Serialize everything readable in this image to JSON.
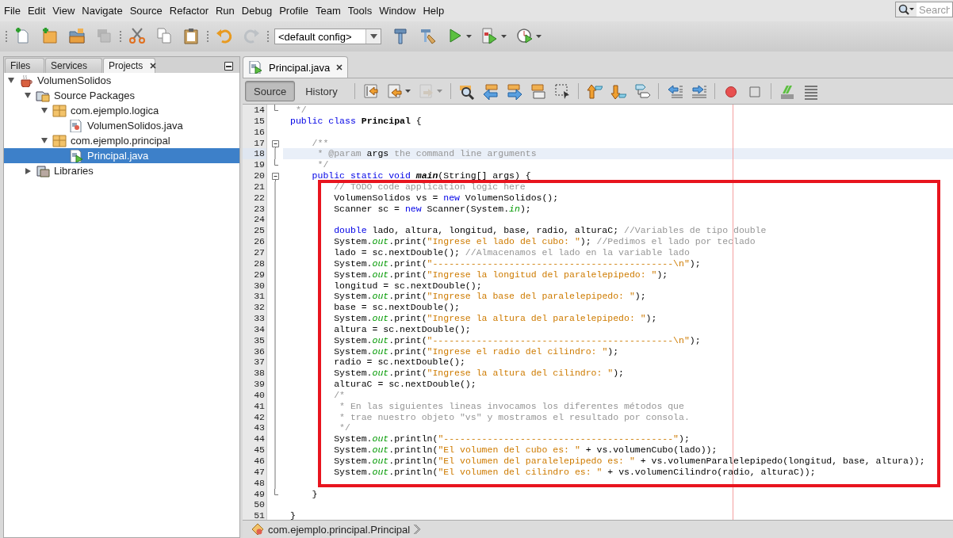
{
  "menu": [
    "File",
    "Edit",
    "View",
    "Navigate",
    "Source",
    "Refactor",
    "Run",
    "Debug",
    "Profile",
    "Team",
    "Tools",
    "Window",
    "Help"
  ],
  "search": {
    "placeholder": "Search"
  },
  "toolbar": {
    "groups": [
      [
        {
          "kind": "new-file",
          "disabled": false
        },
        {
          "kind": "new-project",
          "disabled": false
        },
        {
          "kind": "open-project",
          "disabled": false
        },
        {
          "kind": "save-all",
          "disabled": true
        }
      ],
      [
        {
          "kind": "cut",
          "disabled": false
        },
        {
          "kind": "copy",
          "disabled": false
        },
        {
          "kind": "paste",
          "disabled": false
        }
      ],
      [
        {
          "kind": "undo",
          "disabled": false
        },
        {
          "kind": "redo",
          "disabled": true
        }
      ],
      [
        {
          "kind": "config",
          "value": "<default config>"
        },
        {
          "kind": "build",
          "disabled": false
        },
        {
          "kind": "clean-build",
          "disabled": false
        },
        {
          "kind": "run",
          "disabled": false,
          "dropdown": true
        },
        {
          "kind": "debug",
          "disabled": false,
          "dropdown": true
        },
        {
          "kind": "profile",
          "disabled": false,
          "dropdown": true
        }
      ]
    ]
  },
  "side_tabs": [
    {
      "label": "Files",
      "selected": false
    },
    {
      "label": "Services",
      "selected": false
    },
    {
      "label": "Projects",
      "selected": true
    }
  ],
  "project_tree": [
    {
      "label": "VolumenSolidos",
      "kind": "project",
      "expanded": true,
      "selected": false,
      "children": [
        {
          "label": "Source Packages",
          "kind": "source-root",
          "expanded": true,
          "selected": false,
          "children": [
            {
              "label": "com.ejemplo.logica",
              "kind": "package",
              "expanded": true,
              "selected": false,
              "children": [
                {
                  "label": "VolumenSolidos.java",
                  "kind": "class-file",
                  "selected": false
                }
              ]
            },
            {
              "label": "com.ejemplo.principal",
              "kind": "package",
              "expanded": true,
              "selected": false,
              "children": [
                {
                  "label": "Principal.java",
                  "kind": "main-file",
                  "selected": true
                }
              ]
            }
          ]
        },
        {
          "label": "Libraries",
          "kind": "libraries",
          "expanded": false,
          "selected": false
        }
      ]
    }
  ],
  "editor_tabs": [
    {
      "label": "Principal.java",
      "selected": true
    }
  ],
  "view_tabs": [
    {
      "label": "Source",
      "selected": true
    },
    {
      "label": "History",
      "selected": false
    }
  ],
  "editor_toolbar": {
    "groups": [
      [
        {
          "kind": "last-edit",
          "disabled": false
        },
        {
          "kind": "back",
          "disabled": false,
          "dropdown": true
        },
        {
          "kind": "forward",
          "disabled": true,
          "dropdown": true
        }
      ],
      [
        {
          "kind": "find",
          "disabled": false
        },
        {
          "kind": "prev-occurrence",
          "disabled": false
        },
        {
          "kind": "next-occurrence",
          "disabled": false
        },
        {
          "kind": "toggle-highlight",
          "disabled": false
        },
        {
          "kind": "rect-select",
          "disabled": false
        }
      ],
      [
        {
          "kind": "prev-bookmark",
          "disabled": false
        },
        {
          "kind": "next-bookmark",
          "disabled": false
        },
        {
          "kind": "toggle-bookmark",
          "disabled": false
        }
      ],
      [
        {
          "kind": "shift-left",
          "disabled": false
        },
        {
          "kind": "shift-right",
          "disabled": false
        }
      ],
      [
        {
          "kind": "record-macro",
          "disabled": false
        },
        {
          "kind": "stop-macro",
          "disabled": false
        }
      ],
      [
        {
          "kind": "comment",
          "disabled": false
        },
        {
          "kind": "uncomment",
          "disabled": false
        }
      ]
    ]
  },
  "code": {
    "lines": [
      {
        "number": "14",
        "kind": "end",
        "current": false,
        "tokens": [
          {
            "kind": "comment",
            "text": " */"
          }
        ]
      },
      {
        "number": "15",
        "kind": "plain",
        "current": false,
        "tokens": [
          {
            "kind": "keyword",
            "text": "public class"
          },
          {
            "kind": "class",
            "text": " Principal"
          },
          {
            "kind": "plain",
            "text": " {"
          }
        ]
      },
      {
        "number": "16",
        "kind": "plain"
      },
      {
        "number": "17",
        "kind": "start",
        "current": false,
        "tokens": [
          {
            "kind": "comment",
            "text": "    /**"
          }
        ]
      },
      {
        "number": "18",
        "kind": "body",
        "current": true,
        "tokens": [
          {
            "kind": "comment",
            "text": "     * @param"
          },
          {
            "kind": "plain",
            "text": " args"
          },
          {
            "kind": "comment",
            "text": " the command line arguments"
          }
        ]
      },
      {
        "number": "19",
        "kind": "end",
        "current": false,
        "tokens": [
          {
            "kind": "comment",
            "text": "     */"
          }
        ]
      },
      {
        "number": "20",
        "kind": "start",
        "current": false,
        "tokens": [
          {
            "kind": "keyword",
            "text": "    public static void"
          },
          {
            "kind": "method",
            "text": " main"
          },
          {
            "kind": "plain",
            "text": "(String[] args) {"
          }
        ]
      },
      {
        "number": "21",
        "kind": "body",
        "current": false,
        "tokens": [
          {
            "kind": "comment",
            "text": "        // TODO code application logic here"
          }
        ]
      },
      {
        "number": "22",
        "kind": "body",
        "current": false,
        "tokens": [
          {
            "kind": "plain",
            "text": "        VolumenSolidos vs ="
          },
          {
            "kind": "keyword",
            "text": " new"
          },
          {
            "kind": "plain",
            "text": " VolumenSolidos();"
          }
        ]
      },
      {
        "number": "23",
        "kind": "body",
        "current": false,
        "tokens": [
          {
            "kind": "plain",
            "text": "        Scanner sc ="
          },
          {
            "kind": "keyword",
            "text": " new"
          },
          {
            "kind": "plain",
            "text": " Scanner(System."
          },
          {
            "kind": "field",
            "text": "in"
          },
          {
            "kind": "plain",
            "text": ");"
          }
        ]
      },
      {
        "number": "24",
        "kind": "body"
      },
      {
        "number": "25",
        "kind": "body",
        "current": false,
        "tokens": [
          {
            "kind": "keyword",
            "text": "        double"
          },
          {
            "kind": "plain",
            "text": " lado, altura, longitud, base, radio, alturaC;"
          },
          {
            "kind": "comment",
            "text": " //Variables de tipo double"
          }
        ]
      },
      {
        "number": "26",
        "kind": "body",
        "current": false,
        "tokens": [
          {
            "kind": "plain",
            "text": "        System."
          },
          {
            "kind": "field",
            "text": "out"
          },
          {
            "kind": "plain",
            "text": ".print("
          },
          {
            "kind": "string",
            "text": "\"Ingrese el lado del cubo: \""
          },
          {
            "kind": "plain",
            "text": ");"
          },
          {
            "kind": "comment",
            "text": " //Pedimos el lado por teclado"
          }
        ]
      },
      {
        "number": "27",
        "kind": "body",
        "current": false,
        "tokens": [
          {
            "kind": "plain",
            "text": "        lado = sc.nextDouble();"
          },
          {
            "kind": "comment",
            "text": " //Almacenamos el lado en la variable lado"
          }
        ]
      },
      {
        "number": "28",
        "kind": "body",
        "current": false,
        "tokens": [
          {
            "kind": "plain",
            "text": "        System."
          },
          {
            "kind": "field",
            "text": "out"
          },
          {
            "kind": "plain",
            "text": ".print("
          },
          {
            "kind": "string",
            "text": "\"--------------------------------------------\\n\""
          },
          {
            "kind": "plain",
            "text": ");"
          }
        ]
      },
      {
        "number": "29",
        "kind": "body",
        "current": false,
        "tokens": [
          {
            "kind": "plain",
            "text": "        System."
          },
          {
            "kind": "field",
            "text": "out"
          },
          {
            "kind": "plain",
            "text": ".print("
          },
          {
            "kind": "string",
            "text": "\"Ingrese la longitud del paralelepipedo: \""
          },
          {
            "kind": "plain",
            "text": ");"
          }
        ]
      },
      {
        "number": "30",
        "kind": "body",
        "current": false,
        "tokens": [
          {
            "kind": "plain",
            "text": "        longitud = sc.nextDouble();"
          }
        ]
      },
      {
        "number": "31",
        "kind": "body",
        "current": false,
        "tokens": [
          {
            "kind": "plain",
            "text": "        System."
          },
          {
            "kind": "field",
            "text": "out"
          },
          {
            "kind": "plain",
            "text": ".print("
          },
          {
            "kind": "string",
            "text": "\"Ingrese la base del paralelepipedo: \""
          },
          {
            "kind": "plain",
            "text": ");"
          }
        ]
      },
      {
        "number": "32",
        "kind": "body",
        "current": false,
        "tokens": [
          {
            "kind": "plain",
            "text": "        base = sc.nextDouble();"
          }
        ]
      },
      {
        "number": "33",
        "kind": "body",
        "current": false,
        "tokens": [
          {
            "kind": "plain",
            "text": "        System."
          },
          {
            "kind": "field",
            "text": "out"
          },
          {
            "kind": "plain",
            "text": ".print("
          },
          {
            "kind": "string",
            "text": "\"Ingrese la altura del paralelepipedo: \""
          },
          {
            "kind": "plain",
            "text": ");"
          }
        ]
      },
      {
        "number": "34",
        "kind": "body",
        "current": false,
        "tokens": [
          {
            "kind": "plain",
            "text": "        altura = sc.nextDouble();"
          }
        ]
      },
      {
        "number": "35",
        "kind": "body",
        "current": false,
        "tokens": [
          {
            "kind": "plain",
            "text": "        System."
          },
          {
            "kind": "field",
            "text": "out"
          },
          {
            "kind": "plain",
            "text": ".print("
          },
          {
            "kind": "string",
            "text": "\"--------------------------------------------\\n\""
          },
          {
            "kind": "plain",
            "text": ");"
          }
        ]
      },
      {
        "number": "36",
        "kind": "body",
        "current": false,
        "tokens": [
          {
            "kind": "plain",
            "text": "        System."
          },
          {
            "kind": "field",
            "text": "out"
          },
          {
            "kind": "plain",
            "text": ".print("
          },
          {
            "kind": "string",
            "text": "\"Ingrese el radio del cilindro: \""
          },
          {
            "kind": "plain",
            "text": ");"
          }
        ]
      },
      {
        "number": "37",
        "kind": "body",
        "current": false,
        "tokens": [
          {
            "kind": "plain",
            "text": "        radio = sc.nextDouble();"
          }
        ]
      },
      {
        "number": "38",
        "kind": "body",
        "current": false,
        "tokens": [
          {
            "kind": "plain",
            "text": "        System."
          },
          {
            "kind": "field",
            "text": "out"
          },
          {
            "kind": "plain",
            "text": ".print("
          },
          {
            "kind": "string",
            "text": "\"Ingrese la altura del cilindro: \""
          },
          {
            "kind": "plain",
            "text": ");"
          }
        ]
      },
      {
        "number": "39",
        "kind": "body",
        "current": false,
        "tokens": [
          {
            "kind": "plain",
            "text": "        alturaC = sc.nextDouble();"
          }
        ]
      },
      {
        "number": "40",
        "kind": "body",
        "current": false,
        "tokens": [
          {
            "kind": "comment",
            "text": "        /*"
          }
        ]
      },
      {
        "number": "41",
        "kind": "body",
        "current": false,
        "tokens": [
          {
            "kind": "comment",
            "text": "         * En las siguientes lineas invocamos los diferentes métodos que"
          }
        ]
      },
      {
        "number": "42",
        "kind": "body",
        "current": false,
        "tokens": [
          {
            "kind": "comment",
            "text": "         * trae nuestro objeto \"vs\" y mostramos el resultado por consola."
          }
        ]
      },
      {
        "number": "43",
        "kind": "body",
        "current": false,
        "tokens": [
          {
            "kind": "comment",
            "text": "         */"
          }
        ]
      },
      {
        "number": "44",
        "kind": "body",
        "current": false,
        "tokens": [
          {
            "kind": "plain",
            "text": "        System."
          },
          {
            "kind": "field",
            "text": "out"
          },
          {
            "kind": "plain",
            "text": ".println("
          },
          {
            "kind": "string",
            "text": "\"------------------------------------------\""
          },
          {
            "kind": "plain",
            "text": ");"
          }
        ]
      },
      {
        "number": "45",
        "kind": "body",
        "current": false,
        "tokens": [
          {
            "kind": "plain",
            "text": "        System."
          },
          {
            "kind": "field",
            "text": "out"
          },
          {
            "kind": "plain",
            "text": ".println("
          },
          {
            "kind": "string",
            "text": "\"El volumen del cubo es: \""
          },
          {
            "kind": "plain",
            "text": " + vs.volumenCubo(lado));"
          }
        ]
      },
      {
        "number": "46",
        "kind": "body",
        "current": false,
        "tokens": [
          {
            "kind": "plain",
            "text": "        System."
          },
          {
            "kind": "field",
            "text": "out"
          },
          {
            "kind": "plain",
            "text": ".println("
          },
          {
            "kind": "string",
            "text": "\"El volumen del paralelepipedo es: \""
          },
          {
            "kind": "plain",
            "text": " + vs.volumenParalelepipedo(longitud, base, altura));"
          }
        ]
      },
      {
        "number": "47",
        "kind": "body",
        "current": false,
        "tokens": [
          {
            "kind": "plain",
            "text": "        System."
          },
          {
            "kind": "field",
            "text": "out"
          },
          {
            "kind": "plain",
            "text": ".println("
          },
          {
            "kind": "string",
            "text": "\"El volumen del cilindro es: \""
          },
          {
            "kind": "plain",
            "text": " + vs.volumenCilindro(radio, alturaC));"
          }
        ]
      },
      {
        "number": "48",
        "kind": "body"
      },
      {
        "number": "49",
        "kind": "end",
        "current": false,
        "tokens": [
          {
            "kind": "plain",
            "text": "    }"
          }
        ]
      },
      {
        "number": "50",
        "kind": "plain"
      },
      {
        "number": "51",
        "kind": "plain",
        "current": false,
        "tokens": [
          {
            "kind": "plain",
            "text": "}"
          }
        ]
      }
    ]
  },
  "breadcrumb": {
    "path": "com.ejemplo.principal.Principal"
  }
}
